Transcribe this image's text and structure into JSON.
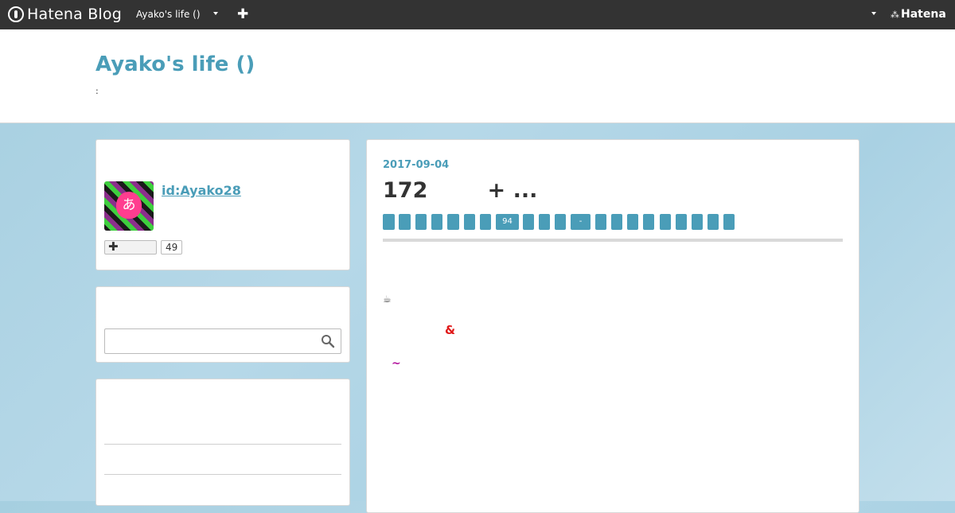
{
  "topbar": {
    "logo_text": "Hatena Blog",
    "blog_switch": "Ayako's life ()",
    "add": "✚",
    "brand": "Hatena",
    "brand_mark": "⁂"
  },
  "header": {
    "title": "Ayako's life ()",
    "description": ":"
  },
  "profile": {
    "id": "id:Ayako28",
    "avatar_char": "あ",
    "follow_icon": "✚",
    "follower_count": "49"
  },
  "search": {
    "placeholder": ""
  },
  "entry": {
    "date": "2017-09-04",
    "title": "172        + ...",
    "categories": [
      "",
      "",
      "",
      "",
      "",
      "",
      "",
      "94",
      "",
      "",
      "",
      "-",
      "",
      "",
      "",
      "",
      "",
      "",
      "",
      "",
      ""
    ],
    "coffee": "☕",
    "amp": "&",
    "tilde": "~"
  },
  "colors": {
    "topbar": "#333333",
    "accent": "#4a9db8",
    "red": "#e01818",
    "purple": "#b4179f"
  },
  "icons": {
    "logo": "hatena-blog-logo-icon",
    "search": "search-icon",
    "avatar_heart": "heart-icon"
  }
}
